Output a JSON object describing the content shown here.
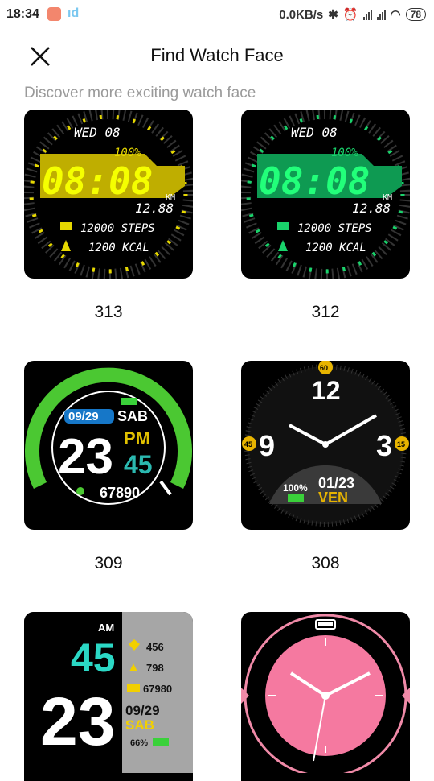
{
  "status": {
    "time": "18:34",
    "speed": "0.0KB/s",
    "battery": "78",
    "icons": [
      "app-icon",
      "app-icon-2",
      "bluetooth-icon",
      "alarm-icon",
      "signal-icon",
      "signal-icon",
      "wifi-icon",
      "battery-icon"
    ]
  },
  "header": {
    "title": "Find Watch Face"
  },
  "subtitle": "Discover more exciting watch face",
  "faces": [
    {
      "id": "313",
      "digital_date": "WED 08",
      "battery": "100%",
      "time_big": "08:08",
      "km_label": "KM",
      "km": "12.88",
      "steps": "12000 STEPS",
      "kcal": "1200 KCAL",
      "accent": "#e6d800"
    },
    {
      "id": "312",
      "digital_date": "WED 08",
      "battery": "100%",
      "time_big": "08:08",
      "km_label": "KM",
      "km": "12.88",
      "steps": "12000 STEPS",
      "kcal": "1200 KCAL",
      "accent": "#19d36b"
    },
    {
      "id": "309",
      "date": "09/29",
      "day": "SAB",
      "hour": "23",
      "ampm": "PM",
      "minute": "45",
      "steps": "67890"
    },
    {
      "id": "308",
      "n12": "12",
      "n3": "3",
      "n9": "9",
      "b60": "60",
      "b15": "15",
      "b45": "45",
      "battery": "100%",
      "date": "01/23",
      "day": "VEN"
    },
    {
      "id": "",
      "ampm": "AM",
      "minute": "45",
      "hour": "23",
      "heart": "456",
      "kcal": "798",
      "steps": "67980",
      "date": "09/29",
      "day": "SAB",
      "battery": "66%"
    },
    {
      "id": ""
    }
  ]
}
